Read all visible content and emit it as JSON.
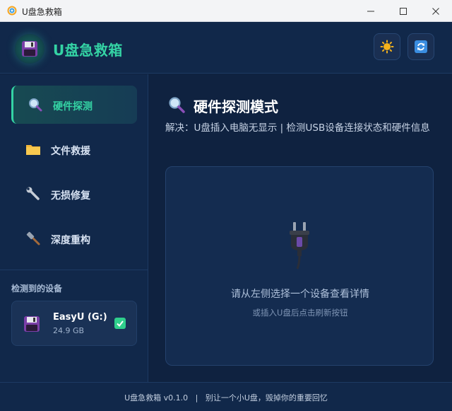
{
  "window": {
    "title": "U盘急救箱"
  },
  "header": {
    "app_title": "U盘急救箱"
  },
  "nav": [
    {
      "label": "硬件探测",
      "icon": "magnifier-icon",
      "active": true
    },
    {
      "label": "文件救援",
      "icon": "folder-icon",
      "active": false
    },
    {
      "label": "无损修复",
      "icon": "wrench-icon",
      "active": false
    },
    {
      "label": "深度重构",
      "icon": "hammer-icon",
      "active": false
    }
  ],
  "devices": {
    "heading": "检测到的设备",
    "items": [
      {
        "name": "EasyU (G:)",
        "size": "24.9 GB",
        "selected": true
      }
    ]
  },
  "main": {
    "title": "硬件探测模式",
    "description": "解决：U盘插入电脑无显示 | 检测USB设备连接状态和硬件信息",
    "empty_title": "请从左侧选择一个设备查看详情",
    "empty_hint": "或插入U盘后点击刷新按钮"
  },
  "footer": {
    "text": "U盘急救箱 v0.1.0   |   别让一个小U盘，毁掉你的重要回忆"
  },
  "colors": {
    "accent": "#34d3a4",
    "background": "#0f2240",
    "panel": "#142c50"
  }
}
